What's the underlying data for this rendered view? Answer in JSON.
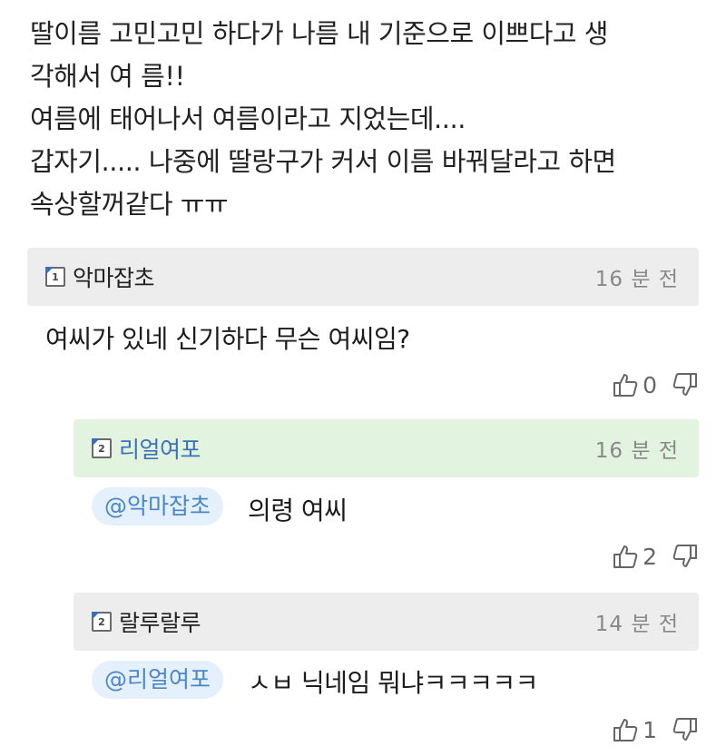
{
  "post": {
    "lines": [
      "딸이름 고민고민 하다가 나름 내 기준으로 이쁘다고 생",
      "각해서 여 름!!",
      "여름에 태어나서 여름이라고 지었는데....",
      "갑자기..... 나중에 딸랑구가 커서 이름 바꿔달라고 하면",
      "속상할꺼같다 ㅠㅠ"
    ]
  },
  "comments": [
    {
      "level": "1",
      "nickname": "악마잡초",
      "time": "16 분 전",
      "text": "여씨가 있네 신기하다 무슨 여씨임?",
      "likes": "0",
      "like_icon": "thumbs-up-icon",
      "dislike_icon": "thumbs-down-icon"
    },
    {
      "level": "2",
      "nickname": "리얼여포",
      "time": "16 분 전",
      "mention": "@악마잡초",
      "text": "의령 여씨",
      "likes": "2",
      "header_color": "#e2f3df",
      "nickname_color": "#3b73b8"
    },
    {
      "level": "2",
      "nickname": "랄루랄루",
      "time": "14 분 전",
      "mention": "@리얼여포",
      "text": "ㅅㅂ 닉네임 뭐냐ㅋㅋㅋㅋㅋ",
      "likes": "1"
    }
  ],
  "colors": {
    "header_gray": "#ededed",
    "mention_bg": "#e4f0fb",
    "mention_text": "#4a86c8"
  }
}
